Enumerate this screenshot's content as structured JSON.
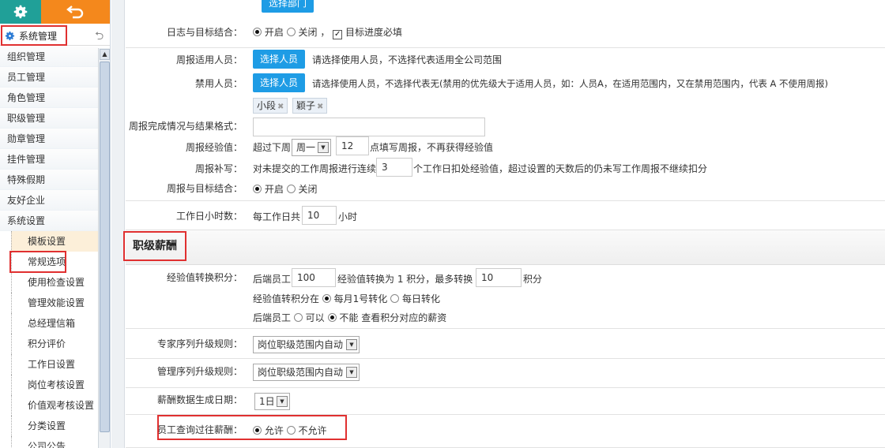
{
  "sidebar": {
    "system_label": "系统管理",
    "menu": [
      "组织管理",
      "员工管理",
      "角色管理",
      "职级管理",
      "勋章管理",
      "挂件管理",
      "特殊假期",
      "友好企业",
      "系统设置"
    ],
    "submenu": [
      "模板设置",
      "常规选项",
      "使用检查设置",
      "管理效能设置",
      "总经理信箱",
      "积分评价",
      "工作日设置",
      "岗位考核设置",
      "价值观考核设置",
      "分类设置",
      "公司公告"
    ]
  },
  "top": {
    "select_dept": "选择部门"
  },
  "log_goal": {
    "label": "日志与目标结合：",
    "on": "开启",
    "off": "关闭",
    "sep": "，",
    "check": "目标进度必填"
  },
  "weekly_users": {
    "label": "周报适用人员：",
    "button": "选择人员",
    "hint": "请选择使用人员，不选择代表适用全公司范围"
  },
  "banned_users": {
    "label": "禁用人员：",
    "button": "选择人员",
    "hint": "请选择使用人员，不选择代表无(禁用的优先级大于适用人员，如：人员A，在适用范围内，又在禁用范围内，代表 A 不使用周报)",
    "tags": [
      "小段",
      "颖子"
    ]
  },
  "weekly_format": {
    "label": "周报完成情况与结果格式：",
    "value": ""
  },
  "weekly_exp": {
    "label": "周报经验值：",
    "prefix": "超过下周",
    "day": "周一",
    "value": "12",
    "suffix": "点填写周报，不再获得经验值"
  },
  "weekly_makeup": {
    "label": "周报补写：",
    "prefix": "对未提交的工作周报进行连续",
    "value": "3",
    "suffix": "个工作日扣处经验值，超过设置的天数后的仍未写工作周报不继续扣分"
  },
  "weekly_goal": {
    "label": "周报与目标结合：",
    "on": "开启",
    "off": "关闭"
  },
  "work_hours": {
    "label": "工作日小时数：",
    "prefix": "每工作日共",
    "value": "10",
    "suffix": "小时"
  },
  "section": {
    "title": "职级薪酬"
  },
  "exp_convert": {
    "label": "经验值转换积分：",
    "line1_a": "后端员工",
    "line1_value": "100",
    "line1_b": "经验值转换为 1 积分，最多转换",
    "line1_max": "10",
    "line1_c": "积分",
    "line2_a": "经验值转积分在",
    "line2_opt1": "每月1号转化",
    "line2_opt2": "每日转化",
    "line3_a": "后端员工",
    "line3_opt1": "可以",
    "line3_opt2": "不能",
    "line3_b": "查看积分对应的薪资"
  },
  "expert_rule": {
    "label": "专家序列升级规则：",
    "value": "岗位职级范围内自动"
  },
  "manage_rule": {
    "label": "管理序列升级规则：",
    "value": "岗位职级范围内自动"
  },
  "salary_date": {
    "label": "薪酬数据生成日期：",
    "value": "1日"
  },
  "salary_query": {
    "label": "员工查询过往薪酬：",
    "allow": "允许",
    "deny": "不允许"
  },
  "colors": {
    "teal": "#20a098",
    "orange": "#f4881c",
    "blue": "#1e9ce5",
    "red": "#e03030"
  }
}
